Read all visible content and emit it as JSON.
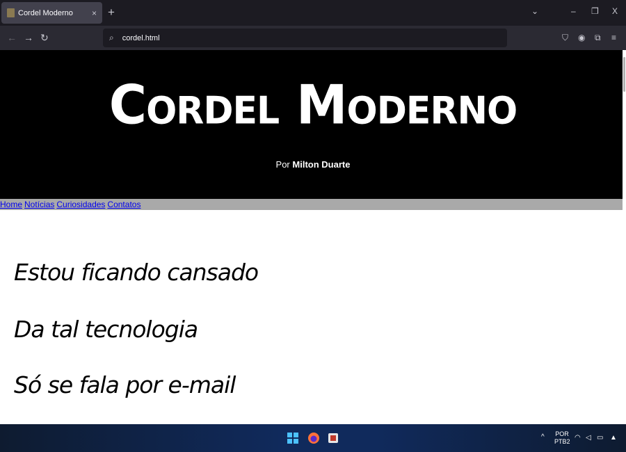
{
  "browser": {
    "tab_title": "Cordel Moderno",
    "tab_close": "×",
    "new_tab": "+",
    "url": "cordel.html",
    "controls": {
      "tab_list": "⌄",
      "minimize": "–",
      "restore": "❐",
      "close": "X"
    }
  },
  "page": {
    "title": "Cordel Moderno",
    "byline_prefix": "Por",
    "author": "Milton Duarte",
    "menu": [
      "Home",
      "Notícias",
      "Curiosidades",
      "Contatos"
    ],
    "verses": [
      "Estou ficando cansado",
      "Da tal tecnologia",
      "Só se fala por e-mail"
    ]
  },
  "taskbar": {
    "language": "POR",
    "layout": "PTB2",
    "chevron": "^"
  }
}
